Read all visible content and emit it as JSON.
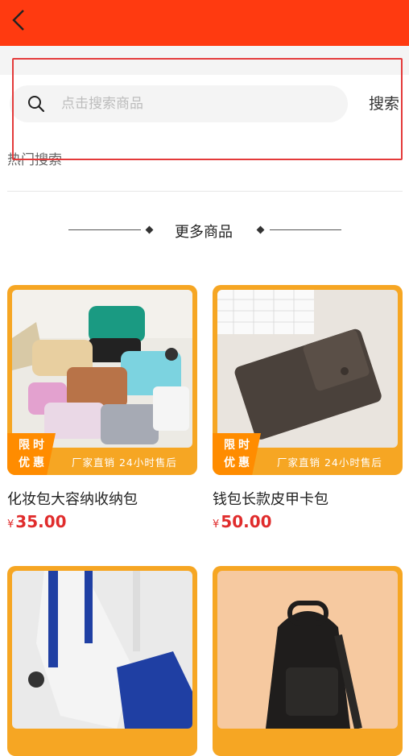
{
  "search": {
    "placeholder": "点击搜索商品",
    "button_label": "搜索",
    "hot_title": "热门搜索"
  },
  "section": {
    "title": "更多商品"
  },
  "products": [
    {
      "name": "化妆包大容纳收纳包",
      "currency": "¥",
      "price": "35.00",
      "badge_line1": "限时",
      "badge_line2": "优惠",
      "ribbon": "厂家直销 24小时售后"
    },
    {
      "name": "钱包长款皮甲卡包",
      "currency": "¥",
      "price": "50.00",
      "badge_line1": "限时",
      "badge_line2": "优惠",
      "ribbon": "厂家直销 24小时售后"
    },
    {
      "name": "",
      "currency": "",
      "price": "",
      "badge_line1": "",
      "badge_line2": "",
      "ribbon": ""
    },
    {
      "name": "",
      "currency": "",
      "price": "",
      "badge_line1": "",
      "badge_line2": "",
      "ribbon": ""
    }
  ],
  "colors": {
    "header": "#ff3a10",
    "accent": "#f6a623",
    "price": "#e02c2c",
    "highlight": "#e43a3a"
  }
}
